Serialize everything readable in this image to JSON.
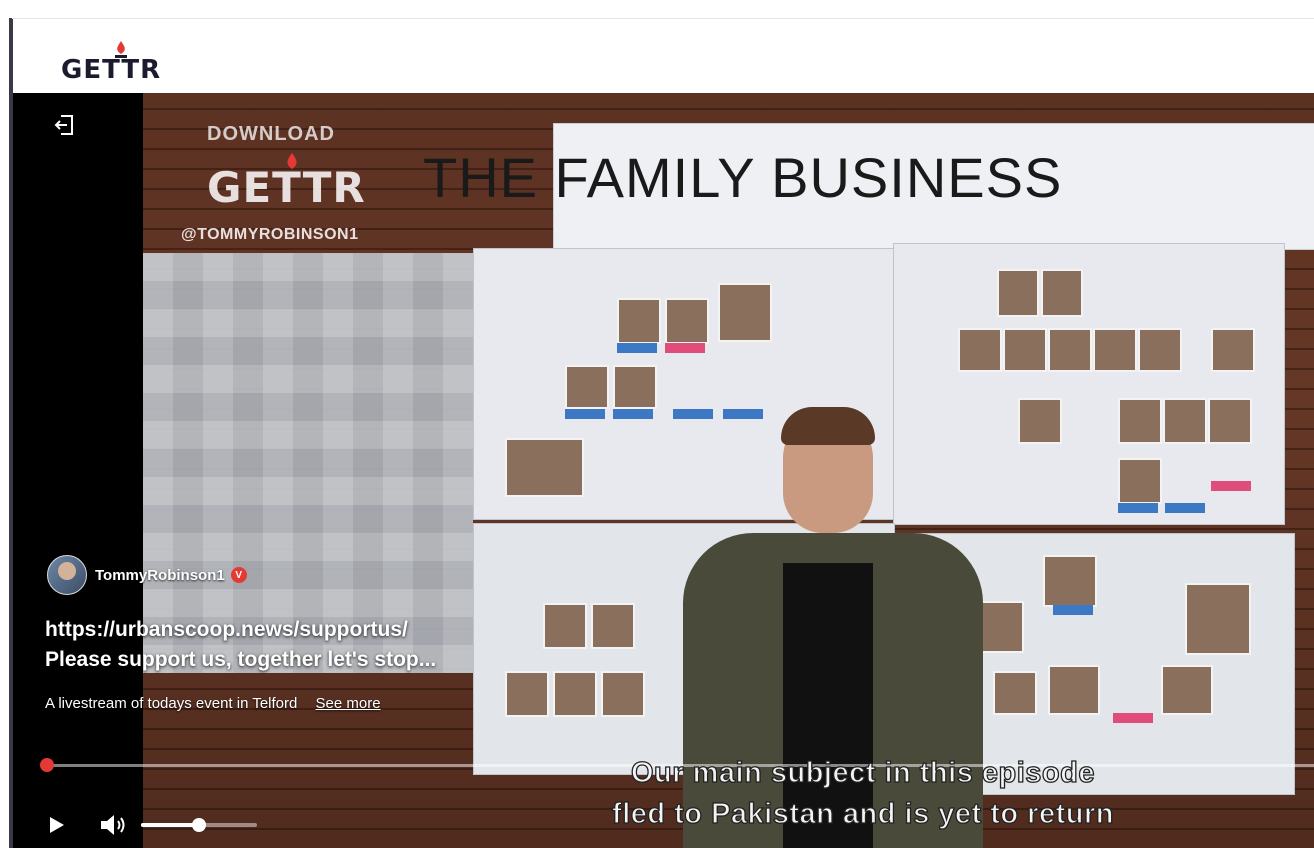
{
  "brand": {
    "logo_text": "GETTR",
    "color": "#1b1b2e",
    "flame_color": "#e53935"
  },
  "video": {
    "board_title": "THE  FAMILY  BUSINESS",
    "watermark": {
      "download": "DOWNLOAD",
      "logo": "GETTR",
      "handle": "@TOMMYROBINSON1"
    },
    "subtitles": [
      "Our main subject in this episode",
      "fled to Pakistan and is yet to return"
    ]
  },
  "post": {
    "channel_name": "TommyRobinson1",
    "verified_icon": "verified-badge-icon",
    "title_line1": "https://urbanscoop.news/supportus/",
    "title_line2": "Please support us, together let's stop...",
    "description": "A livestream of todays event in Telford",
    "see_more": "See more"
  },
  "player": {
    "progress_fraction": 0.0,
    "volume_fraction": 0.5,
    "accent": "#e53935",
    "icons": [
      "exit-icon",
      "play-icon",
      "volume-icon"
    ]
  }
}
